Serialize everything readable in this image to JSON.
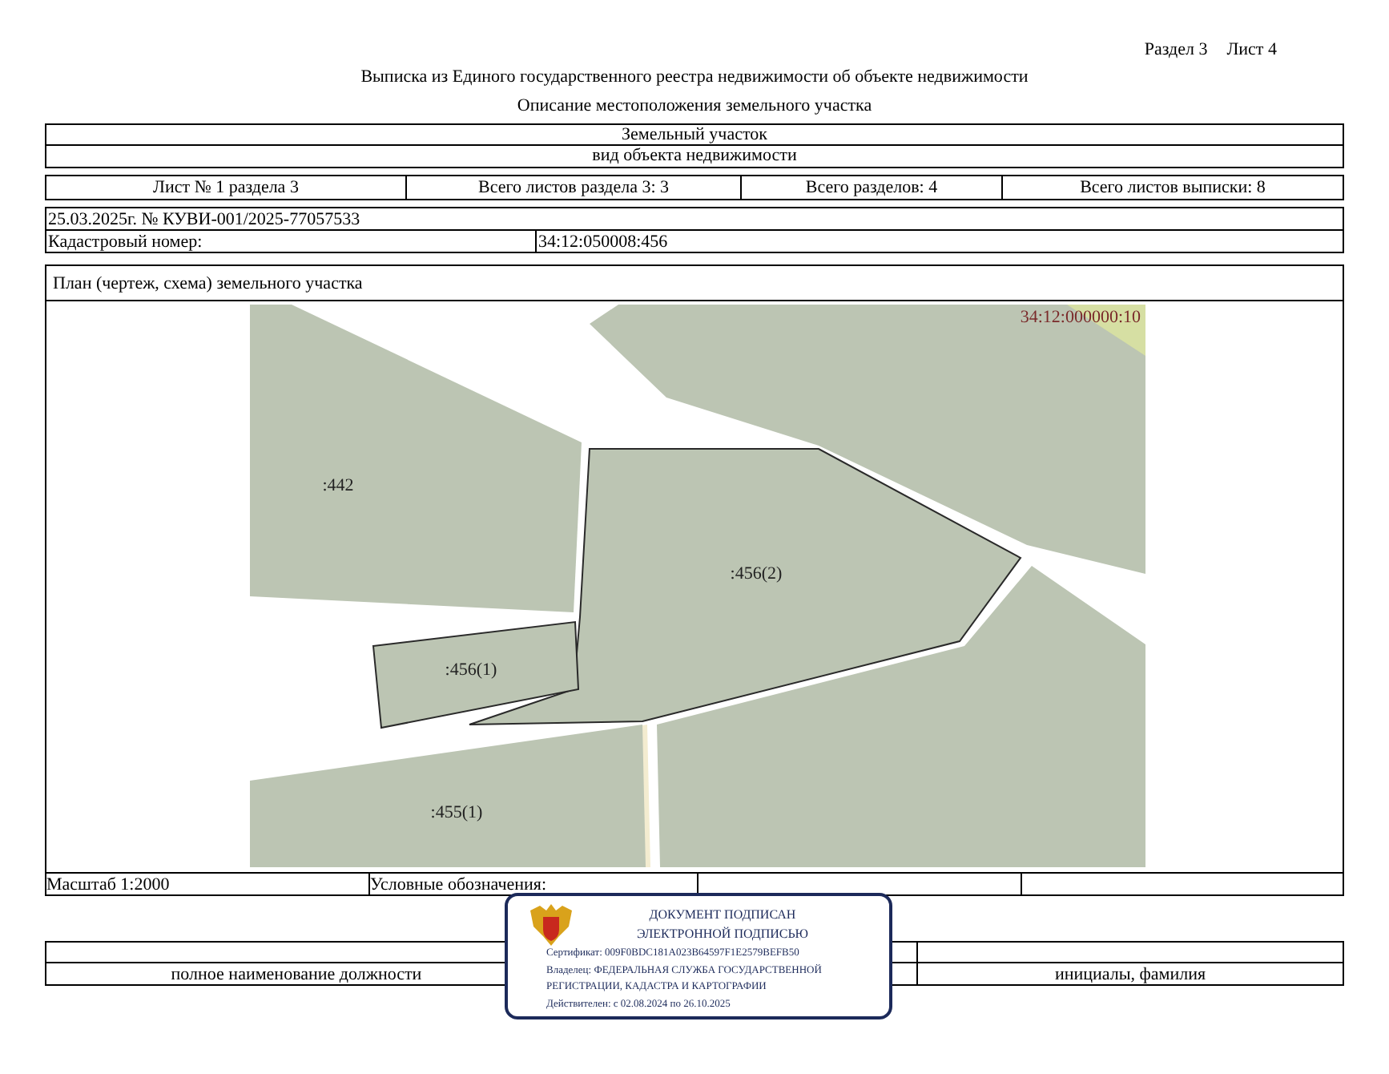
{
  "header": {
    "section": "Раздел 3",
    "sheet": "Лист 4",
    "title": "Выписка из Единого государственного реестра недвижимости об объекте недвижимости",
    "subtitle": "Описание местоположения земельного участка"
  },
  "object_type": {
    "value": "Земельный участок",
    "caption": "вид объекта недвижимости"
  },
  "sheet_info": [
    "Лист № 1 раздела 3",
    "Всего листов раздела 3: 3",
    "Всего разделов: 4",
    "Всего листов выписки: 8"
  ],
  "extract": {
    "number": "25.03.2025г. № КУВИ-001/2025-77057533",
    "cadastral_label": "Кадастровый номер:",
    "cadastral_value": "34:12:050008:456"
  },
  "plan": {
    "title": "План (чертеж, схема) земельного участка",
    "corner_label": "34:12:000000:10",
    "parcels": [
      {
        "label": ":442",
        "highlighted": false
      },
      {
        "label": ":456(2)",
        "highlighted": true
      },
      {
        "label": ":456(1)",
        "highlighted": true
      },
      {
        "label": ":455(1)",
        "highlighted": false
      }
    ]
  },
  "legend": {
    "scale": "Масштаб 1:2000",
    "label": "Условные обозначения:"
  },
  "signature": {
    "position_caption": "полное наименование должности",
    "name_caption": "инициалы, фамилия"
  },
  "stamp": {
    "heading": [
      "ДОКУМЕНТ ПОДПИСАН",
      "ЭЛЕКТРОННОЙ ПОДПИСЬЮ"
    ],
    "details": [
      "Сертификат: 009F0BDC181A023B64597F1E2579BEFB50",
      "Владелец: ФЕДЕРАЛЬНАЯ СЛУЖБА ГОСУДАРСТВЕННОЙ",
      "РЕГИСТРАЦИИ, КАДАСТРА И КАРТОГРАФИИ",
      "Действителен: с 02.08.2024 по 26.10.2025"
    ]
  }
}
